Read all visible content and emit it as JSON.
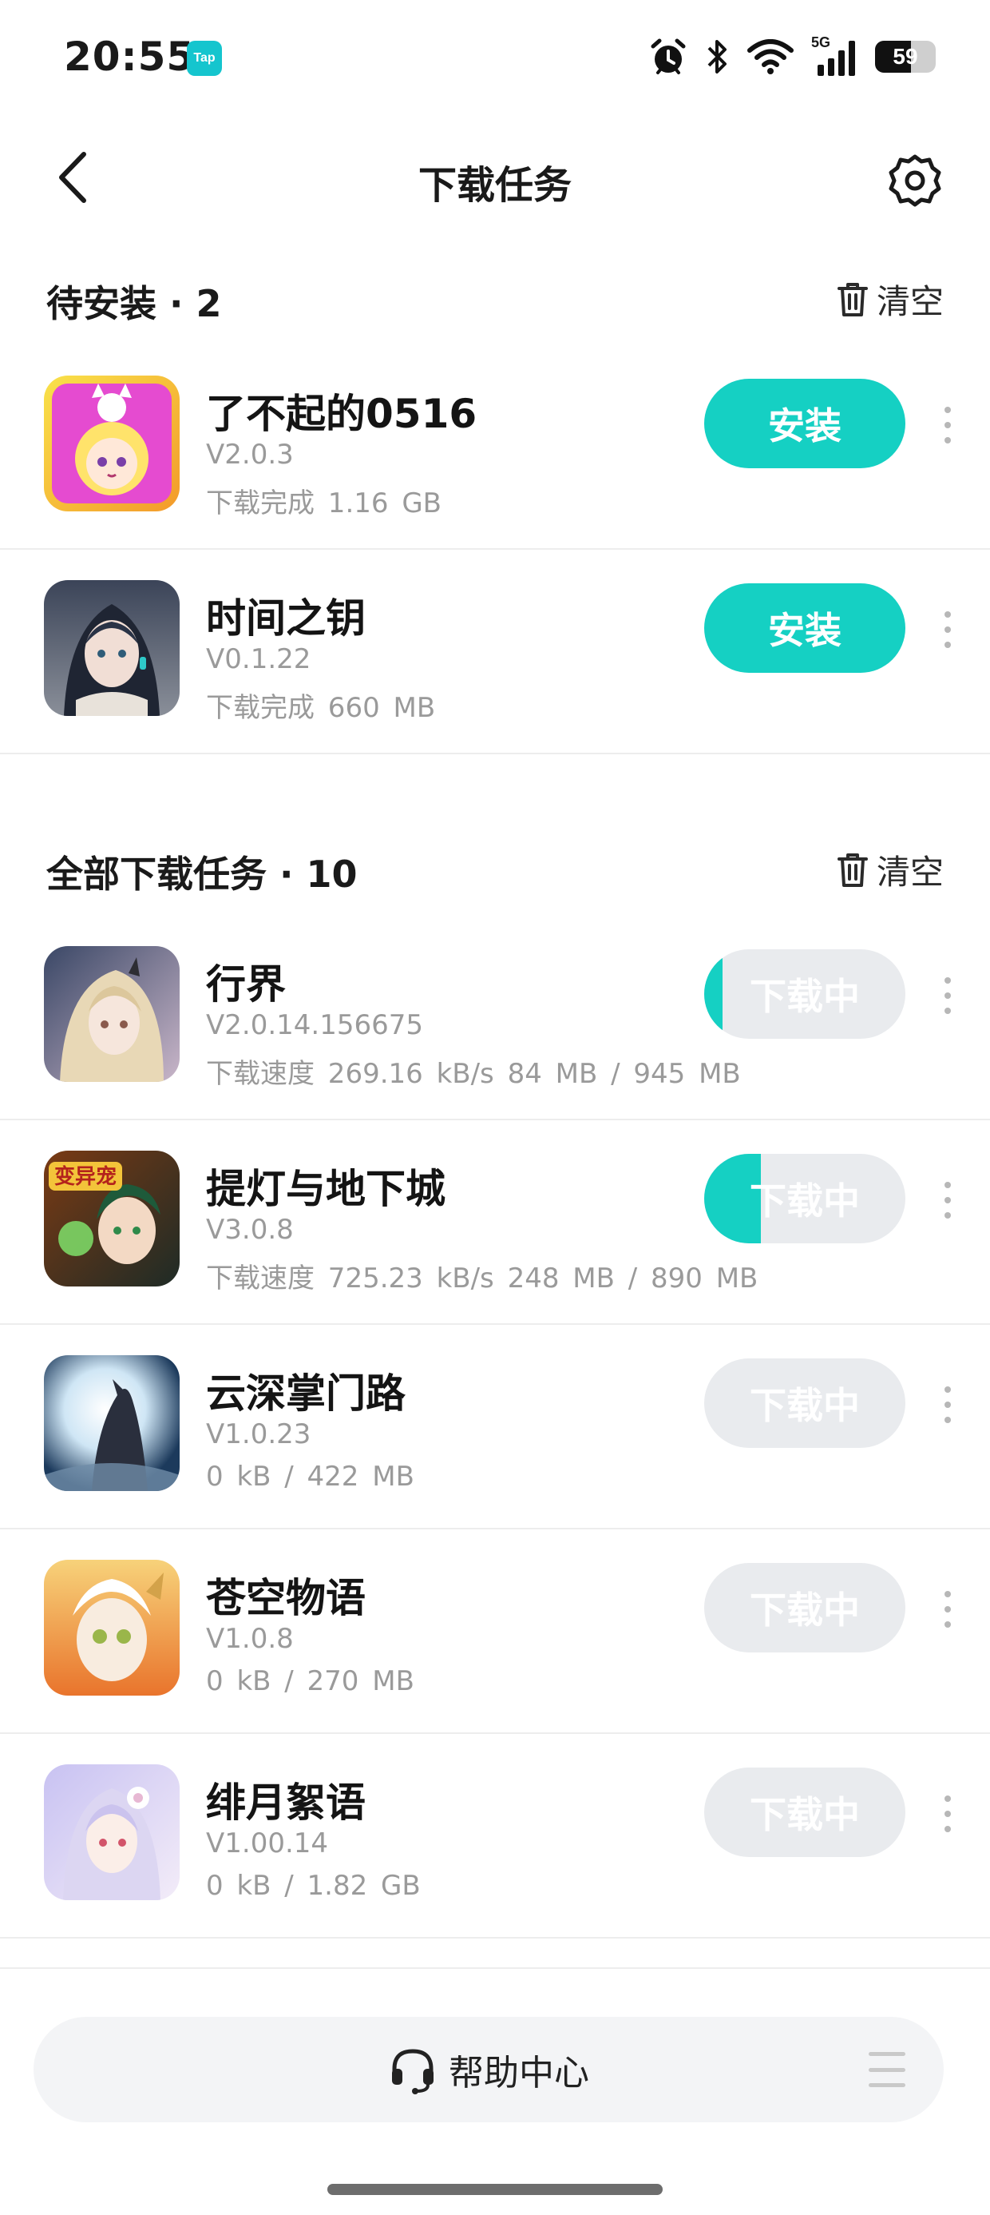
{
  "status_bar": {
    "time": "20:55",
    "tap_badge": "Tap",
    "network": "5G",
    "battery": "59",
    "battery_level": 0.59,
    "icons": [
      "alarm-icon",
      "bluetooth-icon",
      "wifi-icon",
      "signal-icon",
      "battery-icon"
    ]
  },
  "nav": {
    "title": "下载任务",
    "back_icon": "back-chevron-icon",
    "settings_icon": "gear-icon"
  },
  "pending": {
    "title": "待安装 · 2",
    "clear_label": "清空",
    "items": [
      {
        "name": "了不起的0516",
        "version": "V2.0.3",
        "status": "下载完成 1.16 GB",
        "button": "安装"
      },
      {
        "name": "时间之钥",
        "version": "V0.1.22",
        "status": "下载完成 660 MB",
        "button": "安装"
      }
    ]
  },
  "all": {
    "title": "全部下载任务 · 10",
    "clear_label": "清空",
    "items": [
      {
        "name": "行界",
        "version": "V2.0.14.156675",
        "status": "下载速度 269.16 kB/s 84 MB / 945 MB",
        "button": "下载中",
        "progress": 0.09
      },
      {
        "name": "提灯与地下城",
        "version": "V3.0.8",
        "status": "下载速度 725.23 kB/s 248 MB / 890 MB",
        "button": "下载中",
        "progress": 0.28
      },
      {
        "name": "云深掌门路",
        "version": "V1.0.23",
        "status": "0 kB / 422 MB",
        "button": "下载中",
        "progress": 0
      },
      {
        "name": "苍空物语",
        "version": "V1.0.8",
        "status": "0 kB / 270 MB",
        "button": "下载中",
        "progress": 0
      },
      {
        "name": "绯月絮语",
        "version": "V1.00.14",
        "status": "0 kB / 1.82 GB",
        "button": "下载中",
        "progress": 0
      }
    ]
  },
  "bottom": {
    "help_label": "帮助中心",
    "help_icon": "headset-icon",
    "menu_icon": "menu-icon"
  },
  "colors": {
    "accent": "#15d0c3",
    "button_disabled": "#e9ebee",
    "secondary_text": "#9a9a9a"
  }
}
